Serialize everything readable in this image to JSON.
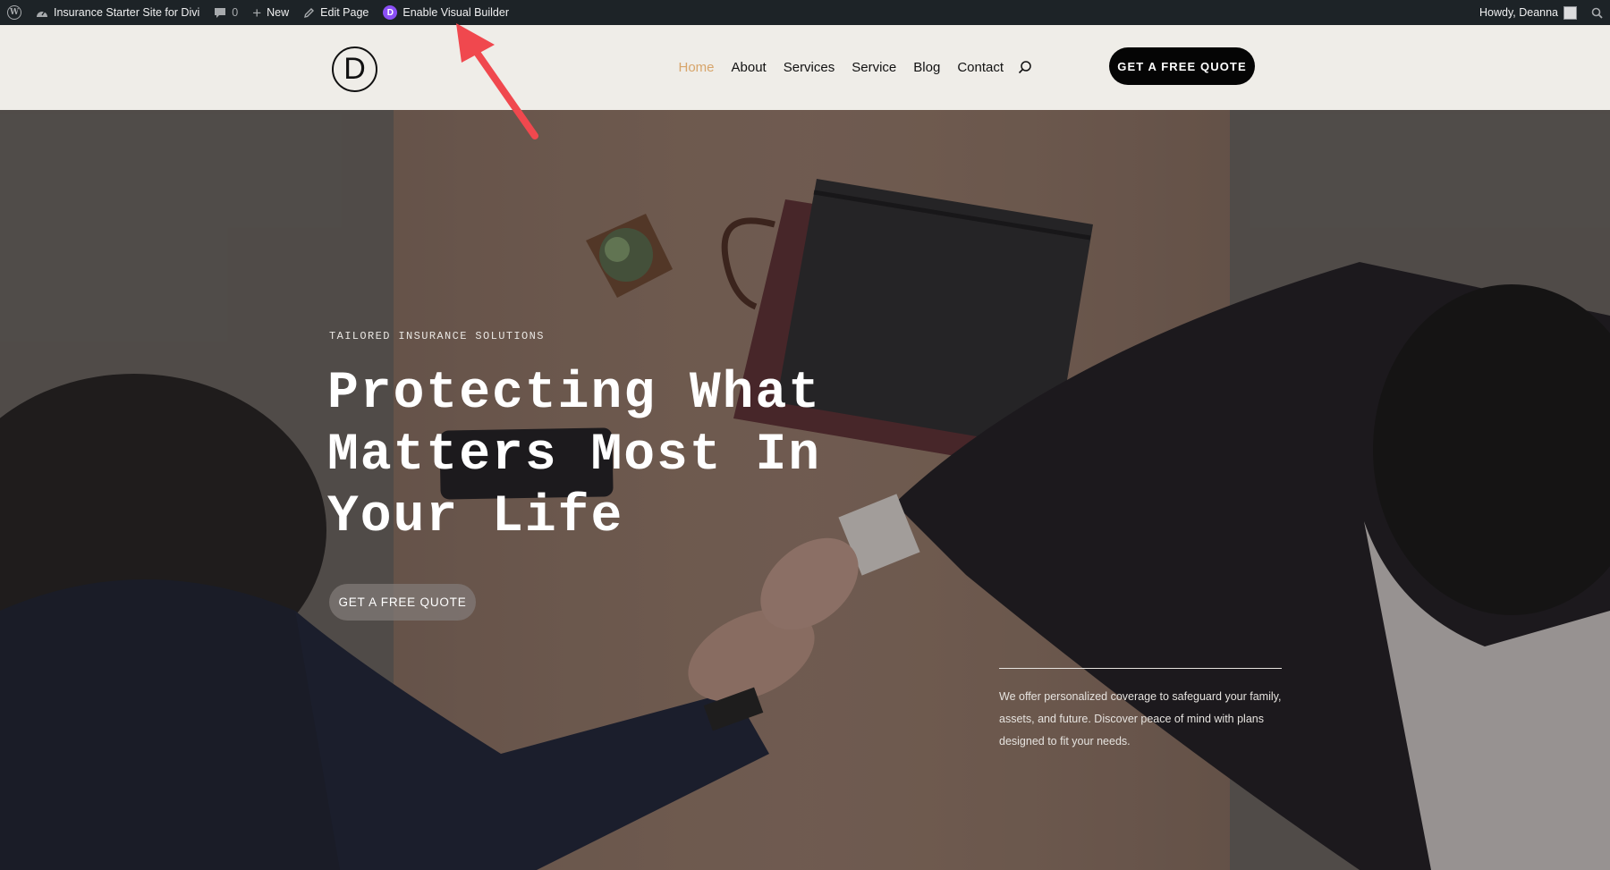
{
  "adminbar": {
    "site_name": "Insurance Starter Site for Divi",
    "comments_count": "0",
    "new_label": "New",
    "edit_label": "Edit Page",
    "visual_builder_label": "Enable Visual Builder",
    "greeting": "Howdy, Deanna"
  },
  "header": {
    "logo_letter": "D",
    "nav": [
      {
        "label": "Home",
        "active": true
      },
      {
        "label": "About"
      },
      {
        "label": "Services"
      },
      {
        "label": "Service"
      },
      {
        "label": "Blog"
      },
      {
        "label": "Contact"
      }
    ],
    "cta_label": "GET A FREE QUOTE"
  },
  "hero": {
    "eyebrow": "TAILORED INSURANCE SOLUTIONS",
    "headline_lines": [
      "Protecting What",
      "Matters Most In",
      "Your Life"
    ],
    "cta_label": "GET A FREE QUOTE",
    "blurb": "We offer personalized coverage to safeguard your family, assets, and future. Discover peace of mind with plans designed to fit your needs."
  },
  "colors": {
    "accent_active_nav": "#d7a56b",
    "annotation_arrow": "#f0484e",
    "divi_purple": "#8b4ff5"
  }
}
